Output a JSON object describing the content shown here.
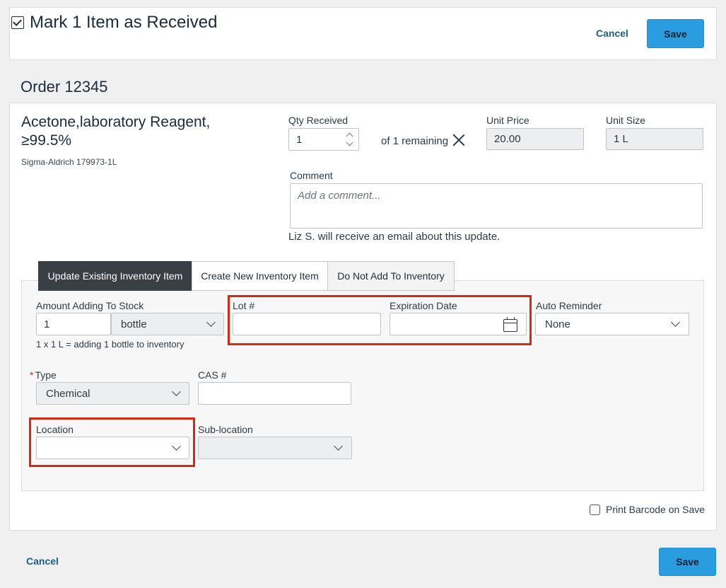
{
  "header": {
    "title": "Mark 1 Item as Received",
    "cancel_label": "Cancel",
    "save_label": "Save"
  },
  "order_title": "Order 12345",
  "product": {
    "name": "Acetone,laboratory Reagent, ≥99.5%",
    "vendor_catalog": "Sigma-Aldrich 179973-1L"
  },
  "qty_received": {
    "label": "Qty Received",
    "value": "1",
    "remaining_text": "of 1 remaining"
  },
  "unit_price": {
    "label": "Unit Price",
    "value": "20.00"
  },
  "unit_size": {
    "label": "Unit Size",
    "value": "1 L"
  },
  "comment": {
    "label": "Comment",
    "placeholder": "Add a comment...",
    "notice": "Liz S. will receive an email about this update."
  },
  "tabs": [
    {
      "label": "Update Existing Inventory Item",
      "active": true
    },
    {
      "label": "Create New Inventory Item",
      "active": false
    },
    {
      "label": "Do Not Add To Inventory",
      "active": false
    }
  ],
  "inventory": {
    "amount_label": "Amount Adding To Stock",
    "amount_value": "1",
    "unit_value": "bottle",
    "conversion_text": "1 x 1 L = adding 1 bottle to inventory",
    "lot_label": "Lot #",
    "lot_value": "",
    "expiration_label": "Expiration Date",
    "expiration_value": "",
    "reminder_label": "Auto Reminder",
    "reminder_value": "None",
    "type_label": "Type",
    "type_value": "Chemical",
    "cas_label": "CAS #",
    "cas_value": "",
    "location_label": "Location",
    "location_value": "",
    "sublocation_label": "Sub-location",
    "sublocation_value": ""
  },
  "print_barcode_label": "Print Barcode on Save",
  "footer": {
    "cancel_label": "Cancel",
    "save_label": "Save"
  },
  "colors": {
    "primary": "#2a9de0",
    "highlight": "#d42a12",
    "active_tab": "#3a3f45",
    "link": "#1a5f86"
  }
}
